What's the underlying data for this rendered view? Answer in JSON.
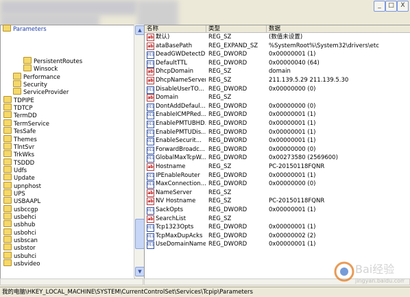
{
  "window": {
    "min_label": "_",
    "max_label": "□",
    "close_label": "X"
  },
  "tree": {
    "top_item": "Parameters",
    "items": [
      {
        "label": "PersistentRoutes",
        "level": 3
      },
      {
        "label": "Winsock",
        "level": 3
      },
      {
        "label": "Performance",
        "level": 2
      },
      {
        "label": "Security",
        "level": 2
      },
      {
        "label": "ServiceProvider",
        "level": 2
      },
      {
        "label": "TDPIPE",
        "level": 1
      },
      {
        "label": "TDTCP",
        "level": 1
      },
      {
        "label": "TermDD",
        "level": 1
      },
      {
        "label": "TermService",
        "level": 1
      },
      {
        "label": "TesSafe",
        "level": 1
      },
      {
        "label": "Themes",
        "level": 1
      },
      {
        "label": "TlntSvr",
        "level": 1
      },
      {
        "label": "TrkWks",
        "level": 1
      },
      {
        "label": "TSDDD",
        "level": 1
      },
      {
        "label": "Udfs",
        "level": 1
      },
      {
        "label": "Update",
        "level": 1
      },
      {
        "label": "upnphost",
        "level": 1
      },
      {
        "label": "UPS",
        "level": 1
      },
      {
        "label": "USBAAPL",
        "level": 1
      },
      {
        "label": "usbccgp",
        "level": 1
      },
      {
        "label": "usbehci",
        "level": 1
      },
      {
        "label": "usbhub",
        "level": 1
      },
      {
        "label": "usbohci",
        "level": 1
      },
      {
        "label": "usbscan",
        "level": 1
      },
      {
        "label": "usbstor",
        "level": 1
      },
      {
        "label": "usbuhci",
        "level": 1
      },
      {
        "label": "usbvideo",
        "level": 1
      }
    ]
  },
  "columns": {
    "name": "名称",
    "type": "类型",
    "data": "数据"
  },
  "values": [
    {
      "icon": "ab",
      "name": "默认)",
      "type": "REG_SZ",
      "data": "(数值未设置)"
    },
    {
      "icon": "ab",
      "name": "ataBasePath",
      "type": "REG_EXPAND_SZ",
      "data": "%SystemRoot%\\System32\\drivers\\etc"
    },
    {
      "icon": "bin",
      "name": "DeadGWDetectD...",
      "type": "REG_DWORD",
      "data": "0x00000001 (1)"
    },
    {
      "icon": "bin",
      "name": "DefaultTTL",
      "type": "REG_DWORD",
      "data": "0x00000040 (64)"
    },
    {
      "icon": "ab",
      "name": "DhcpDomain",
      "type": "REG_SZ",
      "data": "domain"
    },
    {
      "icon": "ab",
      "name": "DhcpNameServer",
      "type": "REG_SZ",
      "data": "211.139.5.29 211.139.5.30"
    },
    {
      "icon": "bin",
      "name": "DisableUserTO...",
      "type": "REG_DWORD",
      "data": "0x00000000 (0)"
    },
    {
      "icon": "ab",
      "name": "Domain",
      "type": "REG_SZ",
      "data": ""
    },
    {
      "icon": "bin",
      "name": "DontAddDefaul...",
      "type": "REG_DWORD",
      "data": "0x00000000 (0)"
    },
    {
      "icon": "bin",
      "name": "EnableICMPRed...",
      "type": "REG_DWORD",
      "data": "0x00000001 (1)"
    },
    {
      "icon": "bin",
      "name": "EnablePMTUBHD...",
      "type": "REG_DWORD",
      "data": "0x00000001 (1)"
    },
    {
      "icon": "bin",
      "name": "EnablePMTUDis...",
      "type": "REG_DWORD",
      "data": "0x00000001 (1)"
    },
    {
      "icon": "bin",
      "name": "EnableSecurit...",
      "type": "REG_DWORD",
      "data": "0x00000001 (1)"
    },
    {
      "icon": "bin",
      "name": "ForwardBroadc...",
      "type": "REG_DWORD",
      "data": "0x00000000 (0)"
    },
    {
      "icon": "bin",
      "name": "GlobalMaxTcpW...",
      "type": "REG_DWORD",
      "data": "0x00273580 (2569600)"
    },
    {
      "icon": "ab",
      "name": "Hostname",
      "type": "REG_SZ",
      "data": "PC-20150118FQNR"
    },
    {
      "icon": "bin",
      "name": "IPEnableRouter",
      "type": "REG_DWORD",
      "data": "0x00000001 (1)"
    },
    {
      "icon": "bin",
      "name": "MaxConnection...",
      "type": "REG_DWORD",
      "data": "0x00000000 (0)"
    },
    {
      "icon": "ab",
      "name": "NameServer",
      "type": "REG_SZ",
      "data": ""
    },
    {
      "icon": "ab",
      "name": "NV Hostname",
      "type": "REG_SZ",
      "data": "PC-20150118FQNR"
    },
    {
      "icon": "bin",
      "name": "SackOpts",
      "type": "REG_DWORD",
      "data": "0x00000001 (1)"
    },
    {
      "icon": "ab",
      "name": "SearchList",
      "type": "REG_SZ",
      "data": ""
    },
    {
      "icon": "bin",
      "name": "Tcp1323Opts",
      "type": "REG_DWORD",
      "data": "0x00000001 (1)"
    },
    {
      "icon": "bin",
      "name": "TcpMaxDupAcks",
      "type": "REG_DWORD",
      "data": "0x00000002 (2)"
    },
    {
      "icon": "bin",
      "name": "UseDomainName...",
      "type": "REG_DWORD",
      "data": "0x00000001 (1)"
    }
  ],
  "status": {
    "path": "我的电脑\\HKEY_LOCAL_MACHINE\\SYSTEM\\CurrentControlSet\\Services\\Tcpip\\Parameters"
  },
  "watermark": {
    "text": "Bai经验",
    "sub": "jingyan.baidu.com"
  }
}
